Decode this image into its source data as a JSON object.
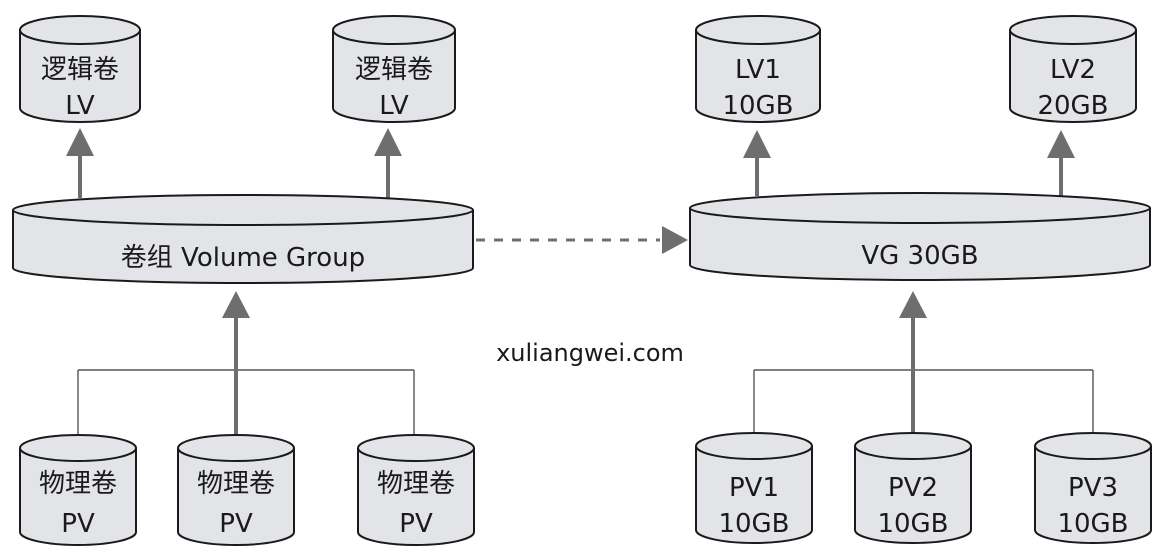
{
  "left": {
    "lv_top": [
      {
        "line1": "逻辑卷",
        "line2": "LV"
      },
      {
        "line1": "逻辑卷",
        "line2": "LV"
      }
    ],
    "vg_label": "卷组 Volume Group",
    "pv_bottom": [
      {
        "line1": "物理卷",
        "line2": "PV"
      },
      {
        "line1": "物理卷",
        "line2": "PV"
      },
      {
        "line1": "物理卷",
        "line2": "PV"
      }
    ]
  },
  "right": {
    "lv_top": [
      {
        "line1": "LV1",
        "line2": "10GB"
      },
      {
        "line1": "LV2",
        "line2": "20GB"
      }
    ],
    "vg_label": "VG 30GB",
    "pv_bottom": [
      {
        "line1": "PV1",
        "line2": "10GB"
      },
      {
        "line1": "PV2",
        "line2": "10GB"
      },
      {
        "line1": "PV3",
        "line2": "10GB"
      }
    ]
  },
  "watermark": "xuliangwei.com",
  "colors": {
    "cylinder_fill": "#e3e4e8",
    "outline": "#1a1a1a",
    "arrow": "#6e6e6e"
  }
}
